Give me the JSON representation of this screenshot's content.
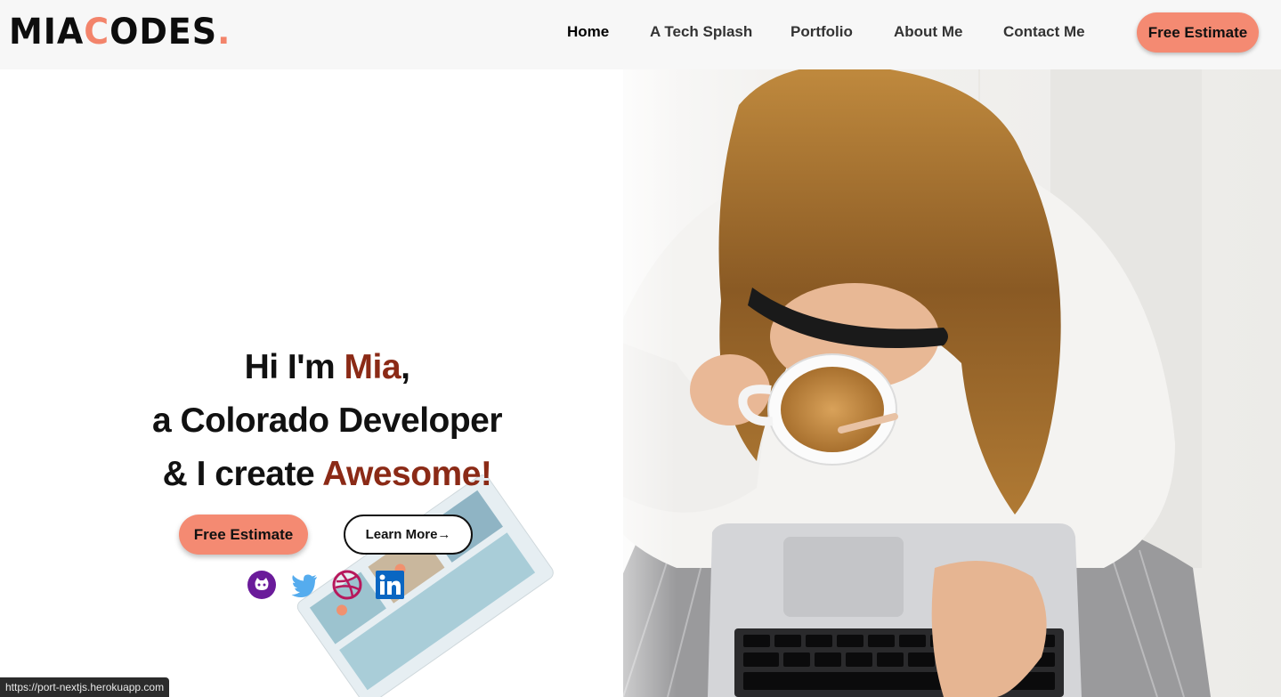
{
  "logo": {
    "part1": "MIA",
    "accent_letter": "C",
    "part2": "ODES",
    "dot": "."
  },
  "nav": {
    "items": [
      {
        "label": "Home",
        "active": true
      },
      {
        "label": "A Tech Splash",
        "active": false
      },
      {
        "label": "Portfolio",
        "active": false
      },
      {
        "label": "About Me",
        "active": false
      },
      {
        "label": "Contact Me",
        "active": false
      }
    ],
    "cta_label": "Free Estimate"
  },
  "hero": {
    "line1_prefix": "Hi I'm ",
    "line1_name": "Mia",
    "line1_suffix": ",",
    "line2": "a Colorado Developer",
    "line3_prefix": "& I create ",
    "line3_highlight": "Awesome!",
    "primary_button": "Free Estimate",
    "secondary_button": "Learn More",
    "secondary_icon": "arrow-right-icon",
    "socials": [
      {
        "name": "github-icon",
        "color": "#6a1b9a"
      },
      {
        "name": "twitter-icon",
        "color": "#55acee"
      },
      {
        "name": "dribbble-icon",
        "color": "#b7185c"
      },
      {
        "name": "linkedin-icon",
        "color": "#0a66c2"
      }
    ]
  },
  "colors": {
    "accent": "#f48a72",
    "highlight": "#8b2a16",
    "header_bg": "#f7f7f7"
  },
  "status_bar": {
    "url": "https://port-nextjs.herokuapp.com"
  }
}
